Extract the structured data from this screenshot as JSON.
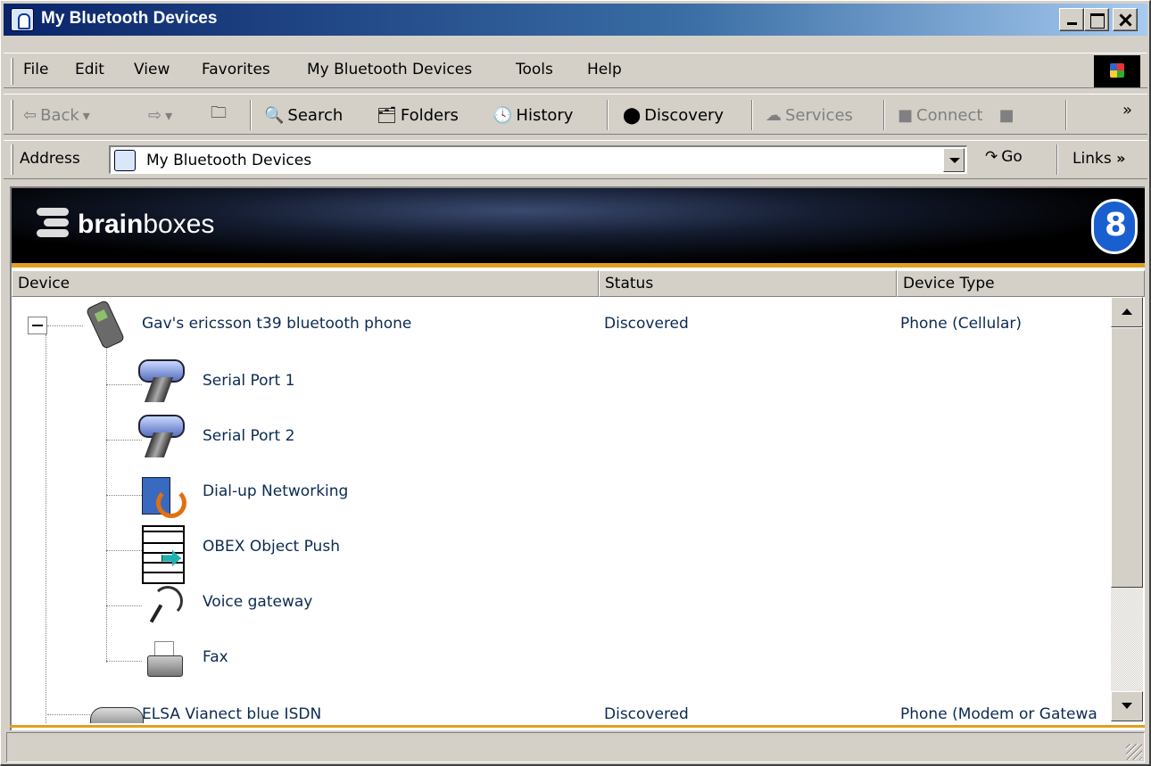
{
  "window": {
    "title": "My Bluetooth Devices"
  },
  "menubar": {
    "items": [
      "File",
      "Edit",
      "View",
      "Favorites",
      "My Bluetooth Devices",
      "Tools",
      "Help"
    ]
  },
  "toolbar": {
    "back": "Back",
    "search": "Search",
    "folders": "Folders",
    "history": "History",
    "discovery": "Discovery",
    "services": "Services",
    "connect": "Connect"
  },
  "address": {
    "label": "Address",
    "value": "My Bluetooth Devices",
    "go": "Go",
    "links": "Links"
  },
  "banner": {
    "brand_bold": "brain",
    "brand_light": "boxes"
  },
  "columns": [
    "Device",
    "Status",
    "Device Type"
  ],
  "devices": [
    {
      "name": "Gav's ericsson t39 bluetooth phone",
      "status": "Discovered",
      "type": "Phone (Cellular)",
      "icon": "mobile-phone-icon",
      "expanded": true,
      "services": [
        {
          "name": "Serial Port 1",
          "icon": "serial-port-icon"
        },
        {
          "name": "Serial Port 2",
          "icon": "serial-port-icon"
        },
        {
          "name": "Dial-up Networking",
          "icon": "dialup-networking-icon"
        },
        {
          "name": "OBEX Object Push",
          "icon": "obex-push-icon"
        },
        {
          "name": "Voice gateway",
          "icon": "headset-icon"
        },
        {
          "name": "Fax",
          "icon": "fax-icon"
        }
      ]
    },
    {
      "name": "ELSA Vianect blue ISDN",
      "status": "Discovered",
      "type": "Phone (Modem or Gatewa",
      "icon": "modem-icon"
    }
  ],
  "colors": {
    "titlebar_start": "#0a246a",
    "titlebar_end": "#a6caf0",
    "accent_stripe": "#e0a020",
    "item_text": "#0b2a52"
  }
}
